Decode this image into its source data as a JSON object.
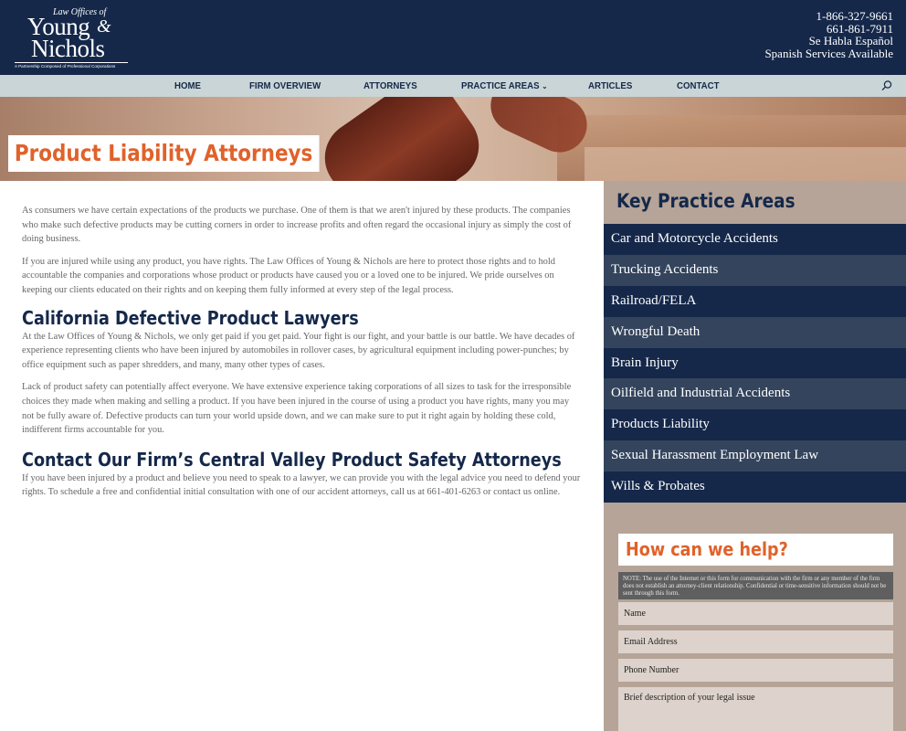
{
  "logo": {
    "top_line": "Law Offices of",
    "name_line1": "Young",
    "ampersand": "&",
    "name_line2": "Nichols",
    "subline": "A Partnership Composed of Professional Corporations"
  },
  "contact": {
    "phone1": "1-866-327-9661",
    "phone2": "661-861-7911",
    "spanish1": "Se Habla Español",
    "spanish2": "Spanish Services Available"
  },
  "nav": {
    "items": [
      "HOME",
      "FIRM OVERVIEW",
      "ATTORNEYS",
      "PRACTICE AREAS",
      "ARTICLES",
      "CONTACT"
    ],
    "caret": "⌄"
  },
  "hero": {
    "title": "Product Liability Attorneys"
  },
  "main": {
    "p1": "As consumers we have certain expectations of the products we purchase. One of them is that we aren't injured by these products. The companies who make such defective products may be cutting corners in order to increase profits and often regard the occasional injury as simply the cost of doing business.",
    "p2": "If you are injured while using any product, you have rights. The Law Offices of Young & Nichols are here to protect those rights and to hold accountable the companies and corporations whose product or products have caused you or a loved one to be injured. We pride ourselves on keeping our clients educated on their rights and on keeping them fully informed at every step of the legal process.",
    "h2a": "California Defective Product Lawyers",
    "p3": "At the Law Offices of Young & Nichols, we only get paid if you get paid. Your fight is our fight, and your battle is our battle. We have decades of experience representing clients who have been injured by automobiles in rollover cases, by agricultural equipment including power-punches; by office equipment such as paper shredders, and many, many other types of cases.",
    "p4": "Lack of product safety can potentially affect everyone. We have extensive experience taking corporations of all sizes to task for the irresponsible choices they made when making and selling a product. If you have been injured in the course of using a product you have rights, many you may not be fully aware of. Defective products can turn your world upside down, and we can make sure to put it right again by holding these cold, indifferent firms accountable for you.",
    "h2b": "Contact Our Firm’s Central Valley Product Safety Attorneys",
    "p5": "If you have been injured by a product and believe you need to speak to a lawyer, we can provide you with the legal advice you need to defend your rights. To schedule a free and confidential initial consultation with one of our accident attorneys, call us at 661-401-6263 or contact us online."
  },
  "sidebar": {
    "title": "Key Practice Areas",
    "items": [
      "Car and Motorcycle Accidents",
      "Trucking Accidents",
      "Railroad/FELA",
      "Wrongful Death",
      "Brain Injury",
      "Oilfield and Industrial Accidents",
      "Products Liability",
      "Sexual Harassment Employment Law",
      "Wills & Probates"
    ],
    "help_title": "How can we help?",
    "note": "NOTE: The use of the Internet or this form for communication with the firm or any member of the firm does not establish an attorney-client relationship. Confidential or time-sensitive information should not be sent through this form.",
    "fields": {
      "name": "Name",
      "email": "Email Address",
      "phone": "Phone Number",
      "issue": "Brief description of your legal issue"
    }
  },
  "colors": {
    "navy": "#15284a",
    "accent_orange": "#e0622a",
    "nav_bg": "#c9d5d6",
    "sidebar_bg": "#b5a497"
  },
  "icons": {
    "search": "search-icon"
  }
}
